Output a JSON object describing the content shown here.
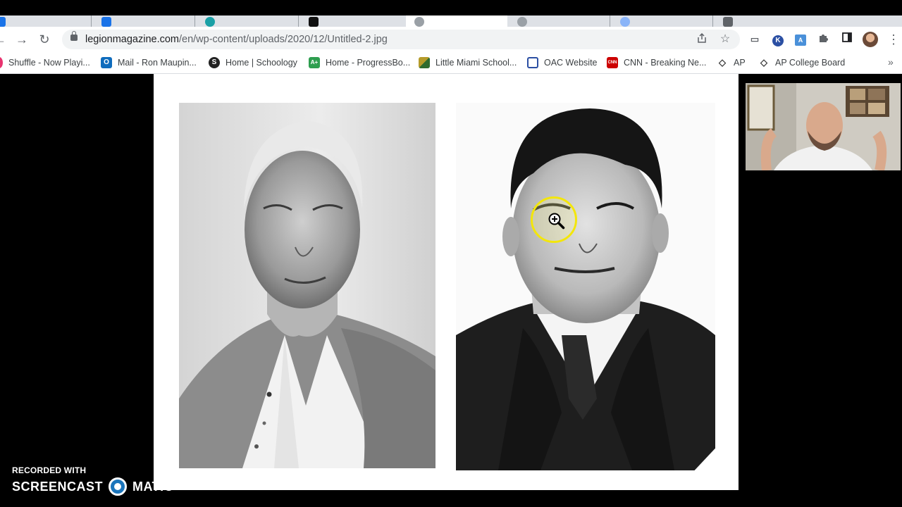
{
  "browser": {
    "url_domain": "legionmagazine.com",
    "url_path": "/en/wp-content/uploads/2020/12/Untitled-2.jpg",
    "nav_icons": [
      "forward-icon",
      "reload-icon",
      "lock-icon"
    ],
    "toolbar_icons": [
      "share-icon",
      "bookmark-star-icon",
      "extension-icon",
      "k-extension-icon",
      "translate-icon",
      "puzzle-icon",
      "side-panel-icon",
      "profile-avatar",
      "kebab-menu-icon"
    ],
    "colors": {
      "tabstrip": "#dee1e6",
      "toolbar": "#ffffff",
      "omnibox": "#f1f3f4"
    }
  },
  "bookmarks": [
    {
      "label": "Shuffle - Now Playi...",
      "icon": "music-icon",
      "color": "#e8336f"
    },
    {
      "label": "Mail - Ron Maupin...",
      "icon": "outlook-icon",
      "color": "#0f6cbd",
      "glyph": "O"
    },
    {
      "label": "Home | Schoology",
      "icon": "schoology-icon",
      "color": "#222222",
      "glyph": "S"
    },
    {
      "label": "Home - ProgressBo...",
      "icon": "progressbook-icon",
      "color": "#2e9e4f",
      "glyph": "A+"
    },
    {
      "label": "Little Miami School...",
      "icon": "little-miami-icon",
      "color": "#b59b2a"
    },
    {
      "label": "OAC Website",
      "icon": "oac-icon",
      "color": "#2b4fa3"
    },
    {
      "label": "CNN - Breaking Ne...",
      "icon": "cnn-icon",
      "color": "#cc0000",
      "glyph": "CNN"
    },
    {
      "label": "AP",
      "icon": "ap-icon",
      "color": "#333333"
    },
    {
      "label": "AP College Board",
      "icon": "ap-college-board-icon",
      "color": "#333333"
    }
  ],
  "watermark": {
    "recorded_with": "RECORDED WITH",
    "brand_left": "SCREENCAST",
    "brand_right": "MATIC"
  },
  "colors": {
    "cursor_ring": "#f3e60b",
    "watermark_dot": "#1b75bb"
  }
}
